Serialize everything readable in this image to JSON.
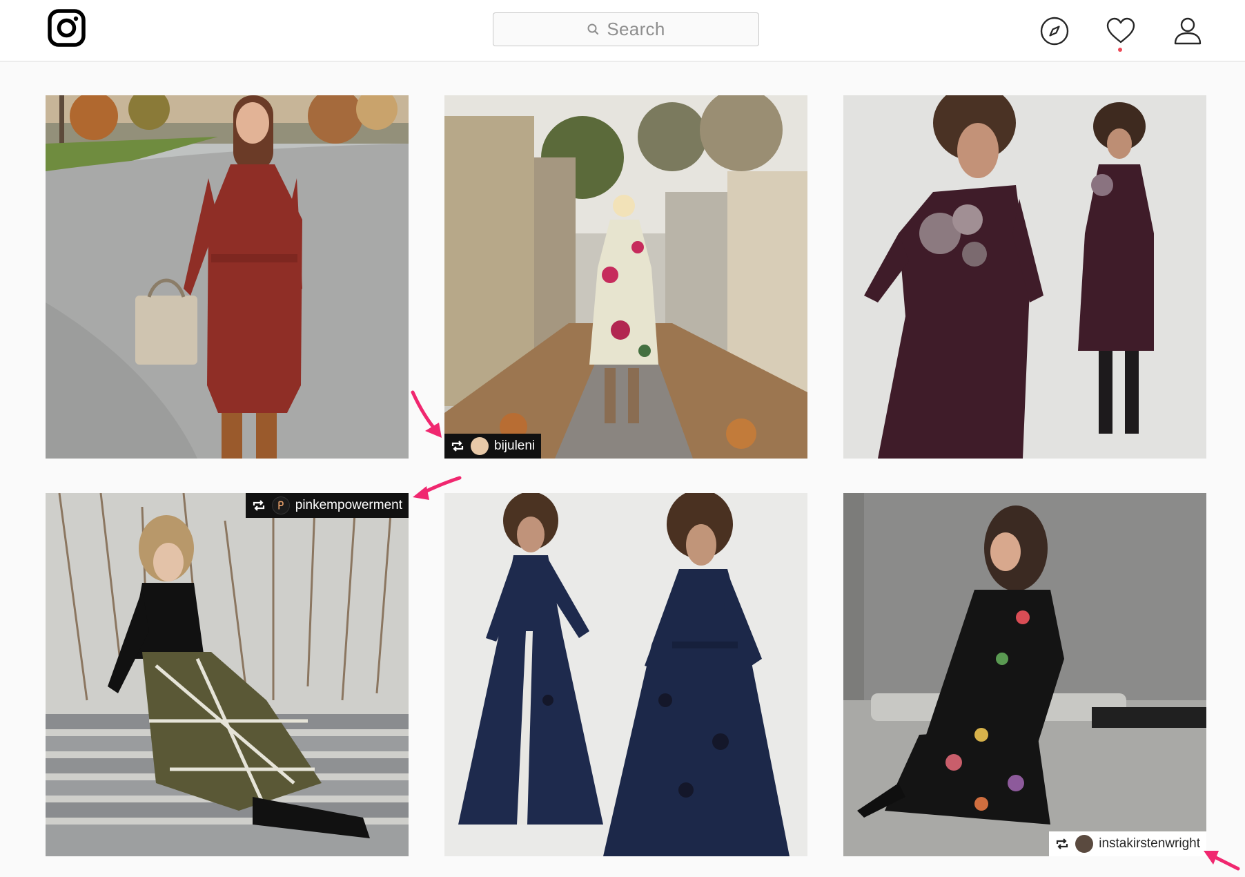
{
  "header": {
    "search": {
      "placeholder": "Search"
    },
    "icons": [
      "instagram-logo-icon",
      "search-icon",
      "compass-icon",
      "heart-icon",
      "user-icon"
    ]
  },
  "posts": [
    {
      "id": "post-1",
      "description": "Woman in red polka-dot wrap dress with tan handbag on autumn street"
    },
    {
      "id": "post-2",
      "description": "Woman in cream floral dress walking down leaf-covered alley",
      "repost_user": "bijuleni"
    },
    {
      "id": "post-3",
      "description": "Model in plum high-neck dress with floral embroidery"
    },
    {
      "id": "post-4",
      "description": "Woman in black top and olive plaid skirt seated on bench",
      "repost_user": "pinkempowerment"
    },
    {
      "id": "post-5",
      "description": "Model in navy floral jacquard shirt gown, two views"
    },
    {
      "id": "post-6",
      "description": "Woman in black floral dress seated by concrete wall",
      "repost_user": "instakirstenwright"
    }
  ],
  "colors": {
    "accent_arrow": "#f0276f",
    "notification_dot": "#ed4956",
    "border": "#dbdbdb",
    "background": "#fafafa"
  }
}
